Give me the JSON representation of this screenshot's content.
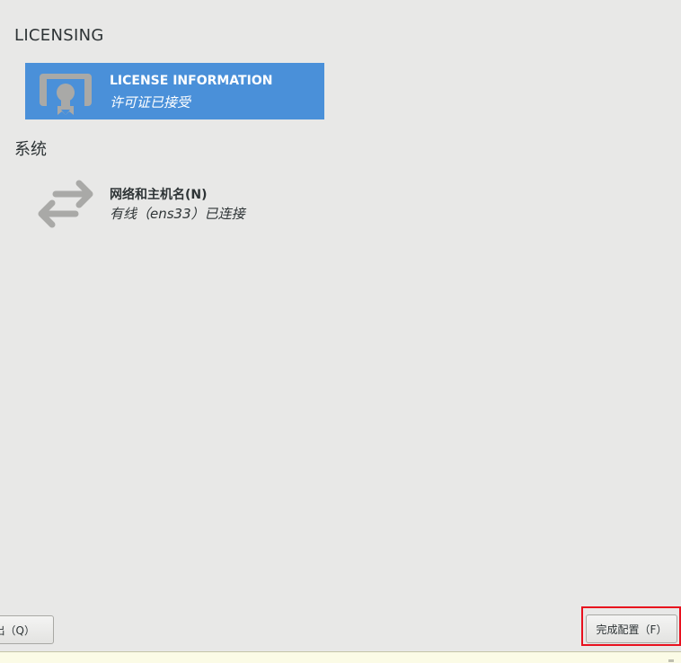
{
  "sections": {
    "licensing": {
      "title": "LICENSING",
      "spokes": [
        {
          "title": "LICENSE INFORMATION",
          "status": "许可证已接受",
          "icon": "certificate-icon",
          "selected": true
        }
      ]
    },
    "system": {
      "title": "系统",
      "spokes": [
        {
          "title": "网络和主机名(N)",
          "status": "有线（ens33）已连接",
          "icon": "network-arrows-icon",
          "selected": false
        }
      ]
    }
  },
  "footer": {
    "quit_label": "出（Q）",
    "finish_label": "完成配置（F）"
  },
  "colors": {
    "selected_background": "#4a90d9",
    "page_background": "#e8e8e7",
    "highlight_box": "#e8111e",
    "icon_gray": "#a9a9a7"
  }
}
